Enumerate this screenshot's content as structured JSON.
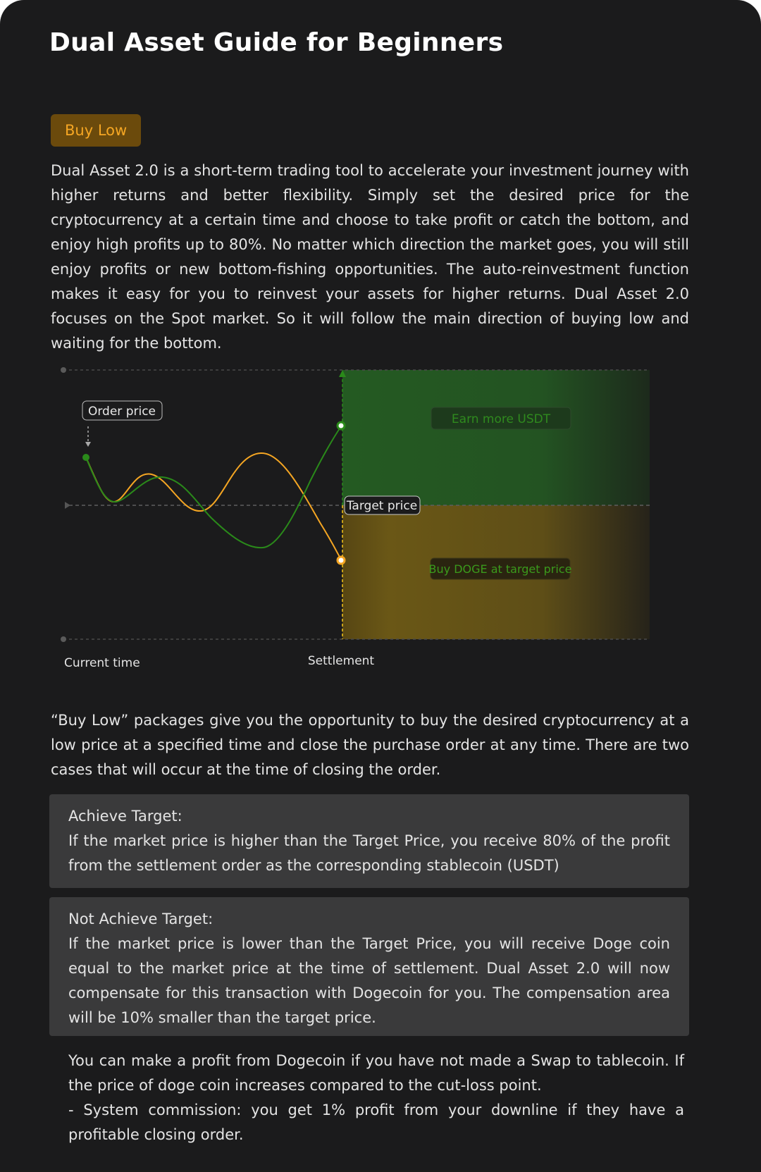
{
  "page": {
    "title": "Dual Asset Guide for Beginners",
    "tag": "Buy Low",
    "intro": "Dual Asset 2.0 is a short-term trading tool to accelerate your investment journey with higher returns and better flexibility. Simply set the desired price for the cryptocurrency at a certain time and choose to take profit or catch the bottom, and enjoy high profits up to 80%. No matter which direction the market goes, you will still enjoy profits or new bottom-fishing opportunities. The auto-reinvestment function makes it easy for you to reinvest your assets for higher returns. Dual Asset 2.0 focuses on the Spot market. So it will follow the main direction of buying low and waiting for the bottom.",
    "buy_low_desc": "“Buy Low” packages give you the opportunity to buy the desired cryptocurrency at a low price at a specified time and close the purchase order at any time. There are two cases that will occur at the time of closing the order."
  },
  "diagram": {
    "order_price_label": "Order price",
    "target_price_label": "Target price",
    "earn_label": "Earn more USDT",
    "buy_label": "Buy DOGE at target price",
    "current_time_label": "Current time",
    "settlement_label": "Settlement",
    "colors": {
      "green": "#2a8a1a",
      "orange": "#f5a623",
      "green_zone": "#245a22",
      "orange_zone": "#6a5716"
    }
  },
  "cases": {
    "achieve": {
      "title": "Achieve Target:",
      "text": "If the market price is higher than the Target Price, you receive 80% of the profit from the settlement order as the corresponding stablecoin (USDT)"
    },
    "not_achieve": {
      "title": "Not Achieve Target:",
      "text": "If the market price is lower than the Target Price, you will receive Doge coin equal to the market price at the time of settlement. Dual Asset 2.0 will now compensate for this transaction with Dogecoin for you. The compensation area will be 10% smaller than the target price."
    }
  },
  "footer": {
    "line1": "You can make a profit from Dogecoin if you have not made a Swap to tablecoin. If the price of doge coin increases compared to the cut-loss point.",
    "line2": "- System commission: you get 1% profit from your downline if they have a profitable closing order."
  }
}
